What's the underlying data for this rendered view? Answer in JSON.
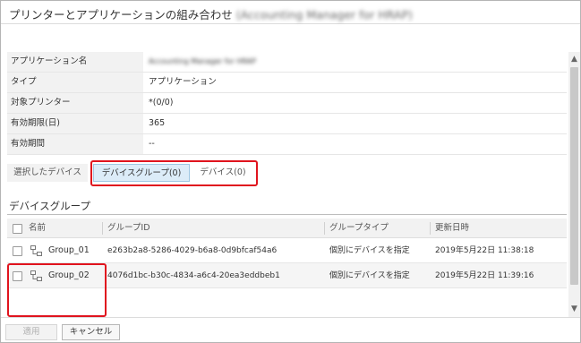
{
  "title": "プリンターとアプリケーションの組み合わせ",
  "title_blurred": "(Accounting Manager for HRAP)",
  "properties": [
    {
      "label": "アプリケーション名",
      "value": "Accounting Manager for HRAP",
      "blurred": true
    },
    {
      "label": "タイプ",
      "value": "アプリケーション",
      "blurred": false
    },
    {
      "label": "対象プリンター",
      "value": "*(0/0)",
      "blurred": false
    },
    {
      "label": "有効期限(日)",
      "value": "365",
      "blurred": false
    },
    {
      "label": "有効期間",
      "value": "--",
      "blurred": false
    }
  ],
  "tabs": {
    "selected_devices": "選択したデバイス",
    "device_group": "デバイスグループ(0)",
    "device": "デバイス(0)"
  },
  "section_title": "デバイスグループ",
  "grid": {
    "headers": {
      "name": "名前",
      "group_id": "グループID",
      "group_type": "グループタイプ",
      "updated": "更新日時"
    },
    "rows": [
      {
        "name": "Group_01",
        "group_id": "e263b2a8-5286-4029-b6a8-0d9bfcaf54a6",
        "group_type": "個別にデバイスを指定",
        "updated": "2019年5月22日 11:38:18"
      },
      {
        "name": "Group_02",
        "group_id": "4076d1bc-b30c-4834-a6c4-20ea3eddbeb1",
        "group_type": "個別にデバイスを指定",
        "updated": "2019年5月22日 11:39:16"
      }
    ]
  },
  "footer": {
    "apply": "適用",
    "cancel": "キャンセル"
  },
  "colors": {
    "accent_tab": "#dcecf8",
    "highlight": "#e0141e"
  }
}
